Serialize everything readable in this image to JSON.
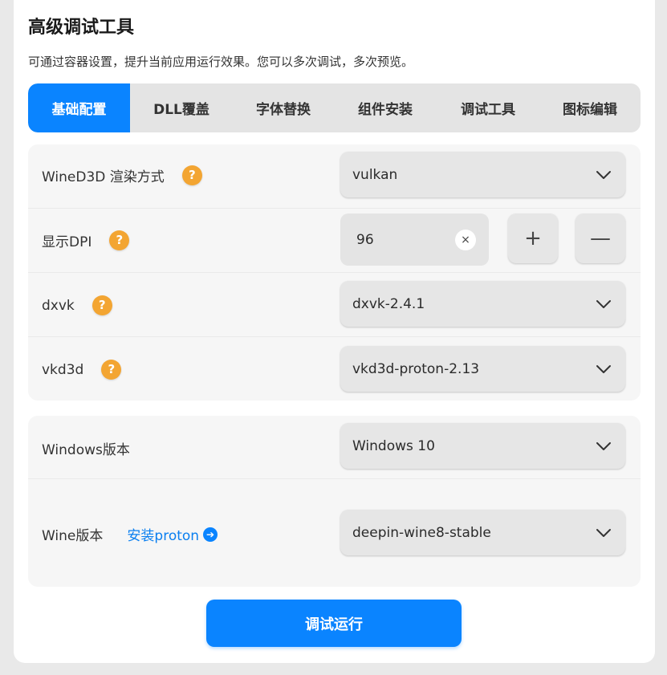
{
  "header": {
    "title": "高级调试工具",
    "description": "可通过容器设置，提升当前应用运行效果。您可以多次调试，多次预览。"
  },
  "tabs": [
    {
      "label": "基础配置",
      "active": true
    },
    {
      "label": "DLL覆盖",
      "active": false
    },
    {
      "label": "字体替换",
      "active": false
    },
    {
      "label": "组件安装",
      "active": false
    },
    {
      "label": "调试工具",
      "active": false
    },
    {
      "label": "图标编辑",
      "active": false
    }
  ],
  "basic": {
    "wined3d": {
      "label": "WineD3D 渲染方式",
      "value": "vulkan",
      "help_icon": "question-circle-icon"
    },
    "dpi": {
      "label": "显示DPI",
      "value": "96",
      "plus": "+",
      "minus": "—",
      "clear": "×"
    },
    "dxvk": {
      "label": "dxvk",
      "value": "dxvk-2.4.1"
    },
    "vkd3d": {
      "label": "vkd3d",
      "value": "vkd3d-proton-2.13"
    }
  },
  "version": {
    "windows": {
      "label": "Windows版本",
      "value": "Windows 10"
    },
    "wine": {
      "label": "Wine版本",
      "link": "安装proton",
      "value": "deepin-wine8-stable"
    }
  },
  "help_text": "?",
  "link_arrow": "➔",
  "actions": {
    "run_label": "调试运行"
  },
  "colors": {
    "accent": "#0a84ff",
    "help": "#f3a532",
    "link": "#0a7ff0"
  }
}
